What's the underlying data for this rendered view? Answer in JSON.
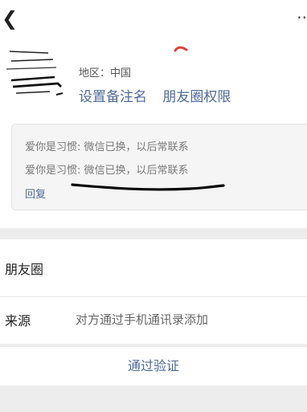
{
  "topbar": {
    "back_icon": "chevron-left-icon",
    "more_icon": "more-dots-icon"
  },
  "profile": {
    "region": "地区：中国",
    "set_remark_label": "设置备注名",
    "moments_permission_label": "朋友圈权限"
  },
  "message": {
    "lines": [
      "爱你是习惯: 微信已换，以后常联系",
      "爱你是习惯: 微信已换，以后常联系"
    ],
    "reply_label": "回复"
  },
  "info": {
    "moments_label": "朋友圈",
    "source_label": "来源",
    "source_value": "对方通过手机通讯录添加"
  },
  "actions": {
    "verify_label": "通过验证"
  },
  "colors": {
    "link": "#4e6b98",
    "background": "#ededed",
    "card": "#ffffff",
    "muted_text": "#7a7a7a",
    "redaction": "#111111",
    "red_mark": "#e0403a"
  }
}
